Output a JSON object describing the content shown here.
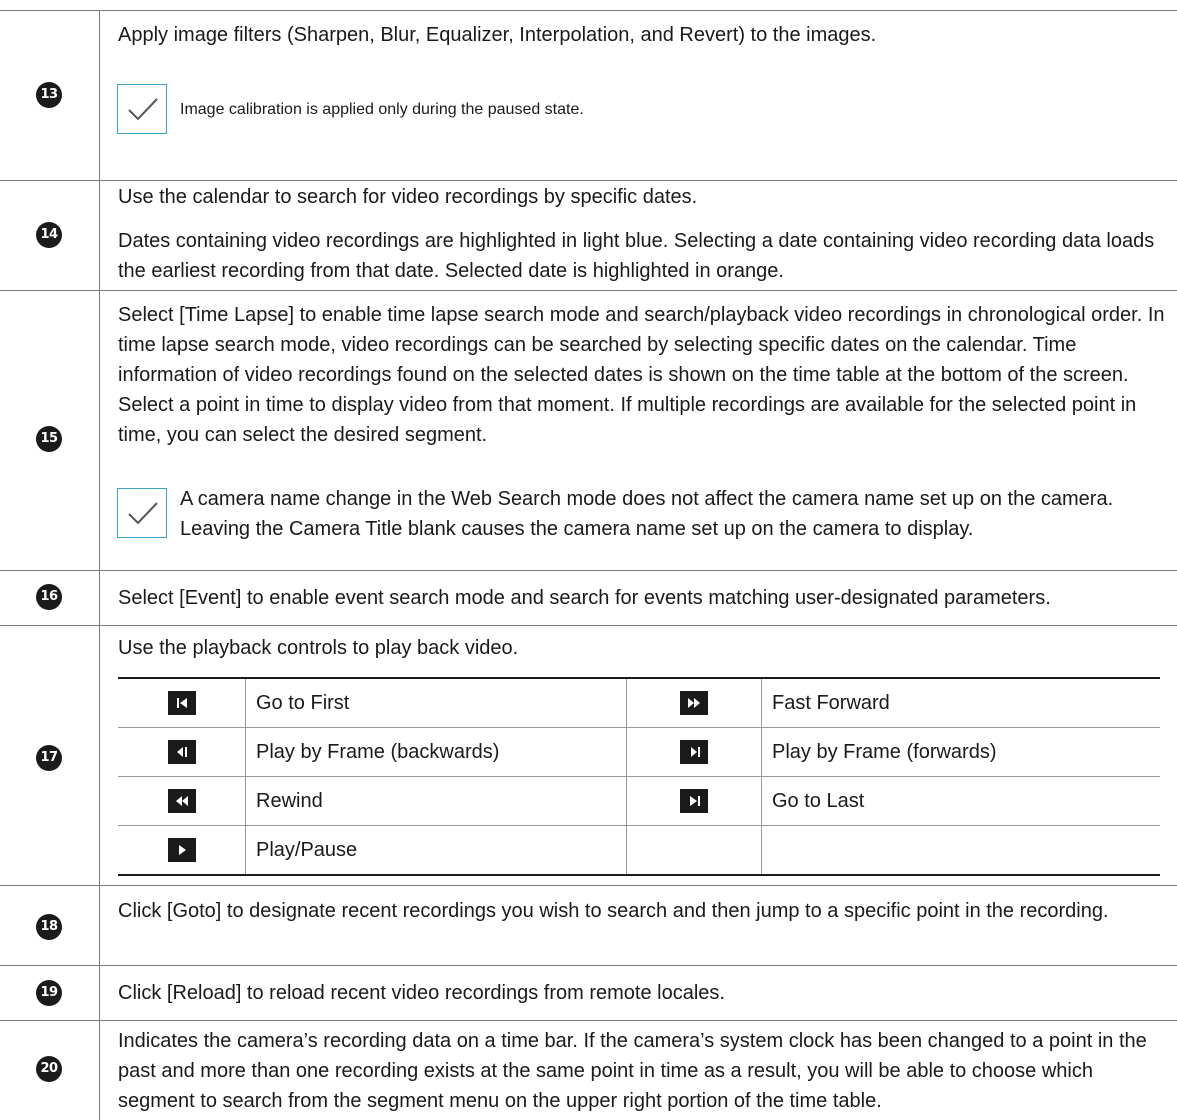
{
  "rows": [
    {
      "num": "13",
      "text": "Apply image filters (Sharpen, Blur, Equalizer, Interpolation, and Revert) to the images.",
      "note": "Image calibration is applied only during the paused state."
    },
    {
      "num": "14",
      "text1": "Use the calendar to search for video recordings by specific dates.",
      "text2": "Dates containing video recordings are highlighted in light blue. Selecting a date containing video recording data loads the earliest recording from that date. Selected date is highlighted in orange."
    },
    {
      "num": "15",
      "text": "Select [Time Lapse] to enable time lapse search mode and search/playback video recordings in chronological order. In time lapse search mode, video recordings can be searched by selecting specific dates on the calendar. Time information of video recordings found on the selected dates is shown on the time table at the bottom of the screen. Select a point in time to display video from that moment. If multiple recordings are available for the selected point in time, you can select the desired segment.",
      "note": "A camera name change in the Web Search mode does not affect the camera name set up on the camera. Leaving the Camera Title blank causes the camera name set up on the camera to display."
    },
    {
      "num": "16",
      "text": "Select [Event] to enable event search mode and search for events matching user-designated parameters."
    },
    {
      "num": "17",
      "text": "Use the playback controls to play back video.",
      "controls": [
        {
          "left_icon": "go-to-first-icon",
          "left_label": "Go to First",
          "right_icon": "fast-forward-icon",
          "right_label": "Fast Forward"
        },
        {
          "left_icon": "play-frame-backward-icon",
          "left_label": "Play by Frame (backwards)",
          "right_icon": "play-frame-forward-icon",
          "right_label": "Play by Frame (forwards)"
        },
        {
          "left_icon": "rewind-icon",
          "left_label": "Rewind",
          "right_icon": "go-to-last-icon",
          "right_label": "Go to Last"
        },
        {
          "left_icon": "play-pause-icon",
          "left_label": "Play/Pause",
          "right_icon": "",
          "right_label": ""
        }
      ]
    },
    {
      "num": "18",
      "text": "Click [Goto] to designate recent recordings you wish to search and then jump to a specific point in the recording."
    },
    {
      "num": "19",
      "text": "Click [Reload] to reload recent video recordings from remote locales."
    },
    {
      "num": "20",
      "text": "Indicates the camera’s recording data on a time bar. If the camera’s system clock has been changed to a point in the past and more than one recording exists at the same point in time as a result, you will be able to choose which segment to search from the segment menu on the upper right portion of the time table."
    }
  ],
  "colors": {
    "check_border": "#3fa2c8",
    "rule": "#7a7a7a",
    "number_bg": "#1b1b1b"
  }
}
